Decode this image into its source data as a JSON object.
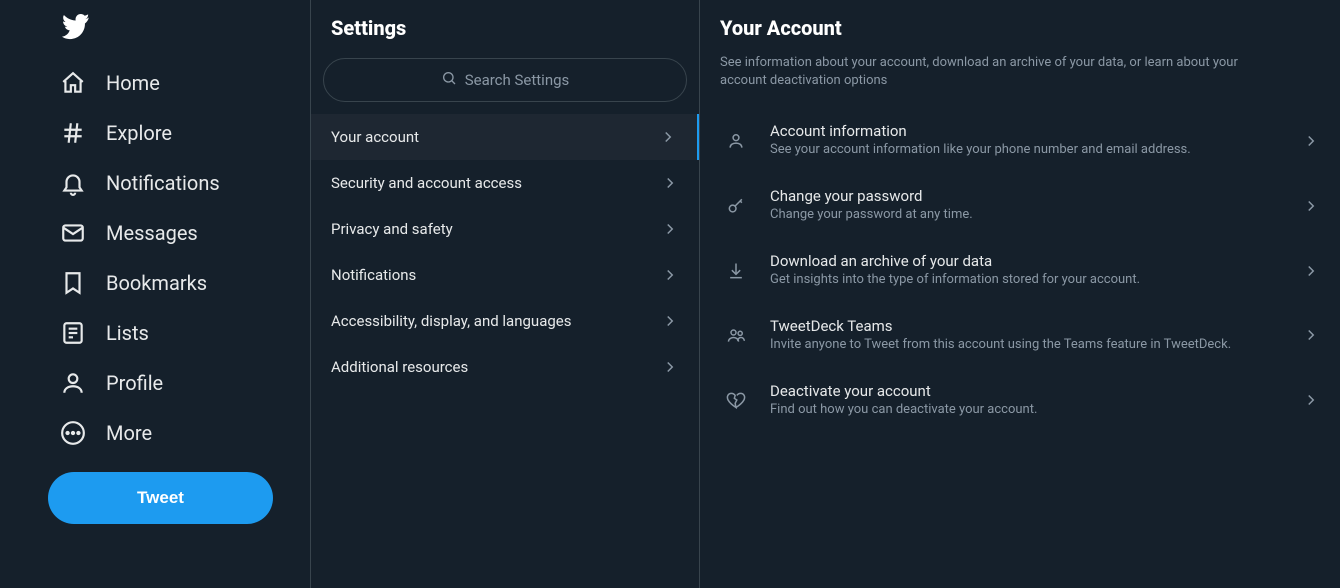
{
  "nav": {
    "items": [
      {
        "label": "Home"
      },
      {
        "label": "Explore"
      },
      {
        "label": "Notifications"
      },
      {
        "label": "Messages"
      },
      {
        "label": "Bookmarks"
      },
      {
        "label": "Lists"
      },
      {
        "label": "Profile"
      },
      {
        "label": "More"
      }
    ],
    "tweet_label": "Tweet"
  },
  "settings": {
    "title": "Settings",
    "search_placeholder": "Search Settings",
    "items": [
      {
        "label": "Your account"
      },
      {
        "label": "Security and account access"
      },
      {
        "label": "Privacy and safety"
      },
      {
        "label": "Notifications"
      },
      {
        "label": "Accessibility, display, and languages"
      },
      {
        "label": "Additional resources"
      }
    ]
  },
  "detail": {
    "title": "Your Account",
    "description": "See information about your account, download an archive of your data, or learn about your account deactivation options",
    "items": [
      {
        "title": "Account information",
        "sub": "See your account information like your phone number and email address."
      },
      {
        "title": "Change your password",
        "sub": "Change your password at any time."
      },
      {
        "title": "Download an archive of your data",
        "sub": "Get insights into the type of information stored for your account."
      },
      {
        "title": "TweetDeck Teams",
        "sub": "Invite anyone to Tweet from this account using the Teams feature in TweetDeck."
      },
      {
        "title": "Deactivate your account",
        "sub": "Find out how you can deactivate your account."
      }
    ]
  }
}
